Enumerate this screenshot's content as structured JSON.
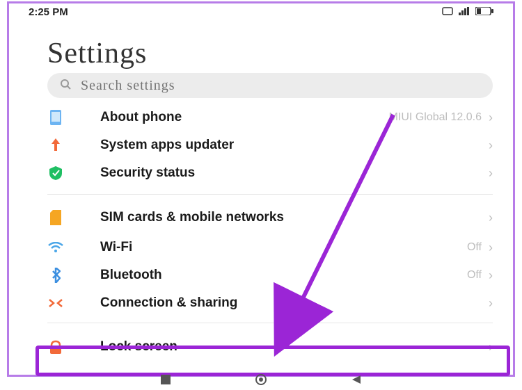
{
  "statusbar": {
    "time": "2:25 PM"
  },
  "page": {
    "title": "Settings"
  },
  "search": {
    "placeholder": "Search settings"
  },
  "items": {
    "about": {
      "label": "About phone",
      "value": "MIUI Global 12.0.6"
    },
    "updater": {
      "label": "System apps updater"
    },
    "security": {
      "label": "Security status"
    },
    "sim": {
      "label": "SIM cards & mobile networks"
    },
    "wifi": {
      "label": "Wi-Fi",
      "value": "Off"
    },
    "bt": {
      "label": "Bluetooth",
      "value": "Off"
    },
    "conn": {
      "label": "Connection & sharing"
    },
    "lock": {
      "label": "Lock screen"
    }
  },
  "colors": {
    "accent": "#9b25d6"
  }
}
